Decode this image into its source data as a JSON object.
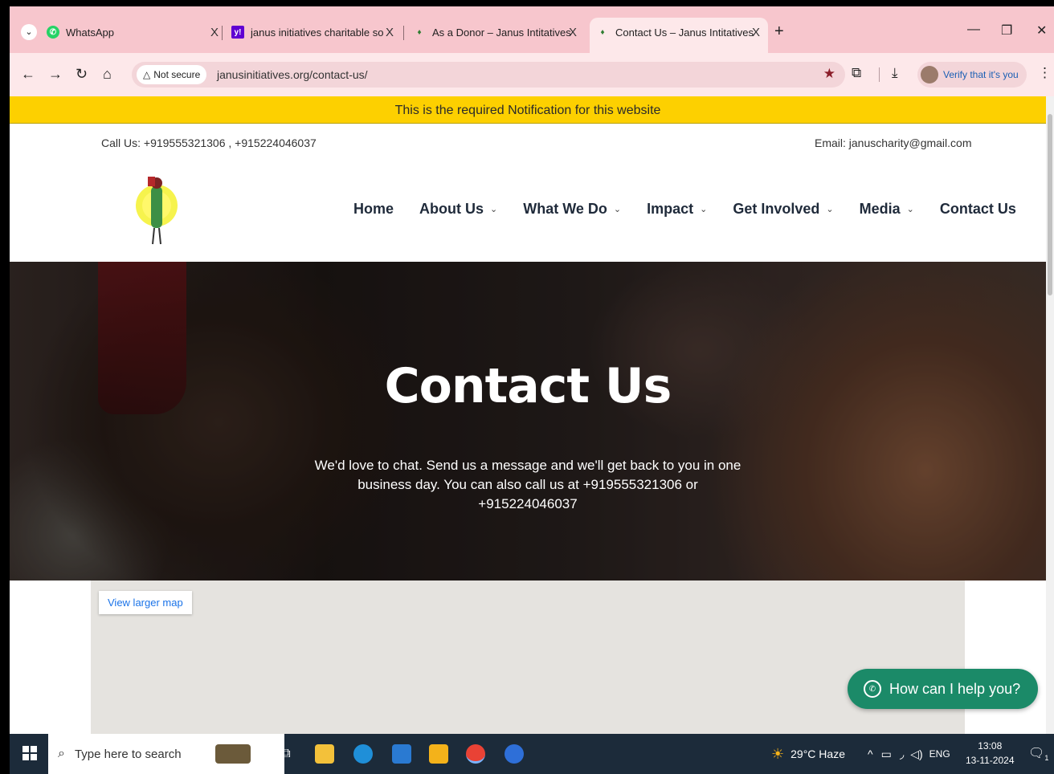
{
  "browser": {
    "tabs": [
      {
        "title": "WhatsApp",
        "favicon": "whatsapp-icon",
        "active": false
      },
      {
        "title": "janus initiatives charitable socie",
        "favicon": "yahoo-icon",
        "active": false
      },
      {
        "title": "As a Donor – Janus Intitatives",
        "favicon": "janus-icon",
        "active": false
      },
      {
        "title": "Contact Us – Janus Intitatives",
        "favicon": "janus-icon",
        "active": true
      }
    ],
    "close_glyph": "X",
    "new_tab_glyph": "+",
    "security_label": "Not secure",
    "url": "janusinitiatives.org/contact-us/",
    "profile_label": "Verify that it's you"
  },
  "page": {
    "notification": "This is the required Notification for this website",
    "call": "Call Us: +919555321306 , +915224046037",
    "email": "Email: januscharity@gmail.com",
    "nav": [
      {
        "label": "Home",
        "dropdown": false
      },
      {
        "label": "About Us",
        "dropdown": true
      },
      {
        "label": "What We Do",
        "dropdown": true
      },
      {
        "label": "Impact",
        "dropdown": true
      },
      {
        "label": "Get Involved",
        "dropdown": true
      },
      {
        "label": "Media",
        "dropdown": true
      },
      {
        "label": "Contact Us",
        "dropdown": false
      }
    ],
    "hero": {
      "title": "Contact Us",
      "text": "We'd love to chat. Send us a message and we'll get back to you in one business day. You can also call us at +919555321306 or +915224046037"
    },
    "map_link": "View larger map",
    "chat_button": "How can I help you?"
  },
  "taskbar": {
    "search_placeholder": "Type here to search",
    "weather": "29°C  Haze",
    "language": "ENG",
    "time": "13:08",
    "date": "13-11-2024",
    "notification_count": "1"
  },
  "colors": {
    "tab_strip": "#f7c6cd",
    "notice_bar": "#fdd000",
    "chat_button": "#1b8a68",
    "taskbar": "#1c2b3a"
  }
}
